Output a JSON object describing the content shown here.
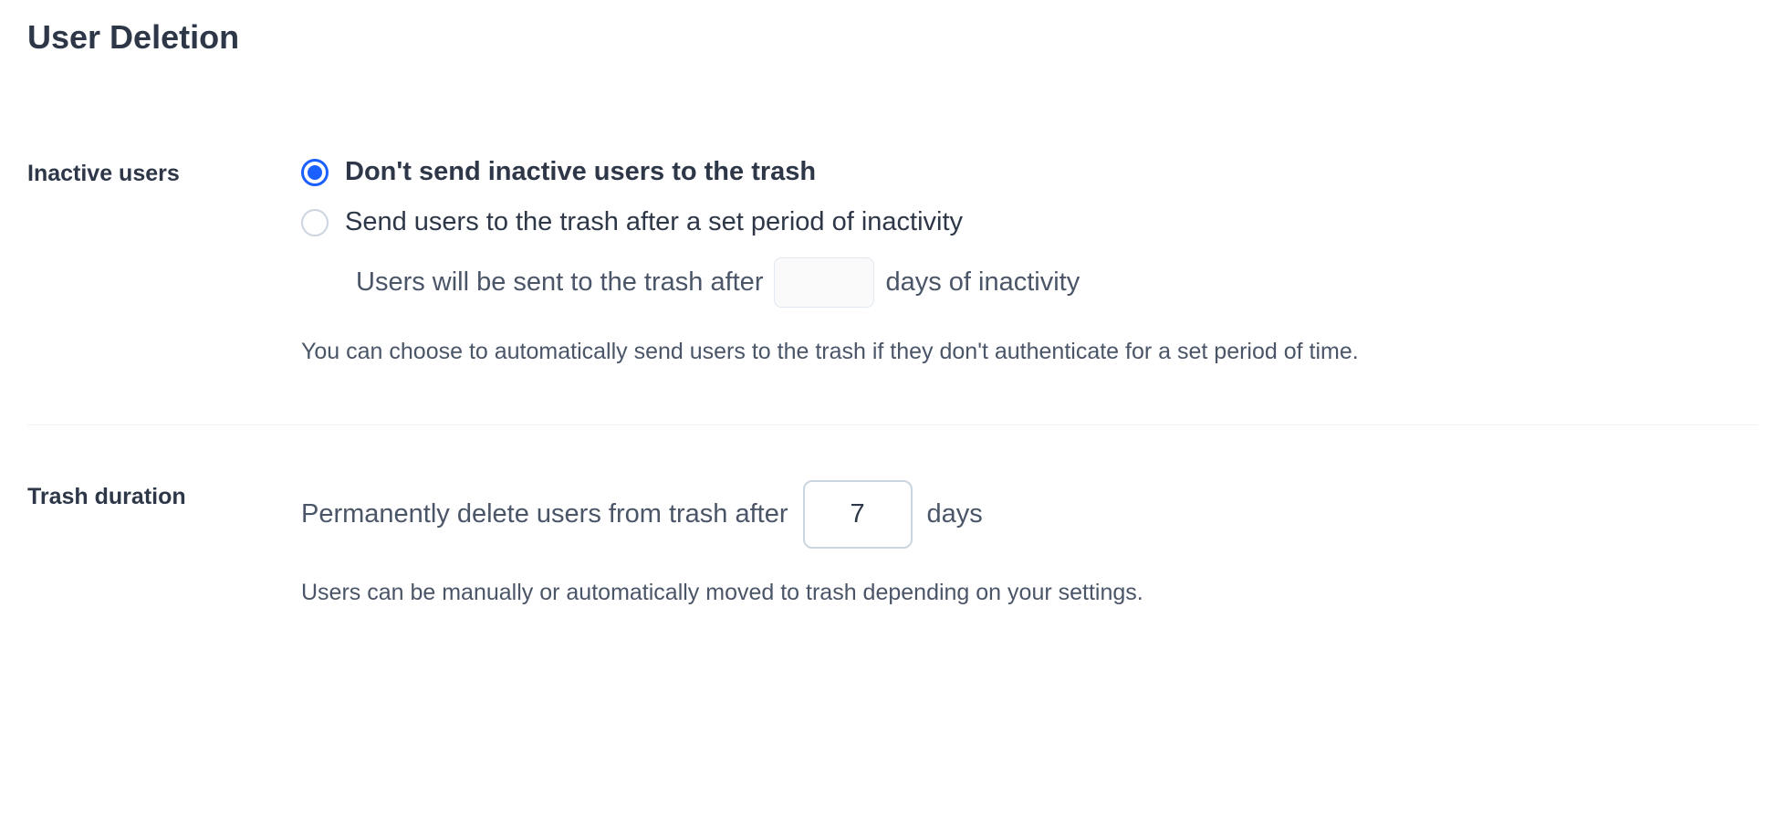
{
  "title": "User Deletion",
  "inactive_users": {
    "label": "Inactive users",
    "option_dont_send": "Don't send inactive users to the trash",
    "option_send": "Send users to the trash after a set period of inactivity",
    "inline_prefix": "Users will be sent to the trash after",
    "inline_suffix": "days of inactivity",
    "inactivity_days": "",
    "help_text": "You can choose to automatically send users to the trash if they don't authenticate for a set period of time."
  },
  "trash_duration": {
    "label": "Trash duration",
    "prefix": "Permanently delete users from trash after",
    "suffix": "days",
    "value": "7",
    "help_text": "Users can be manually or automatically moved to trash depending on your settings."
  }
}
